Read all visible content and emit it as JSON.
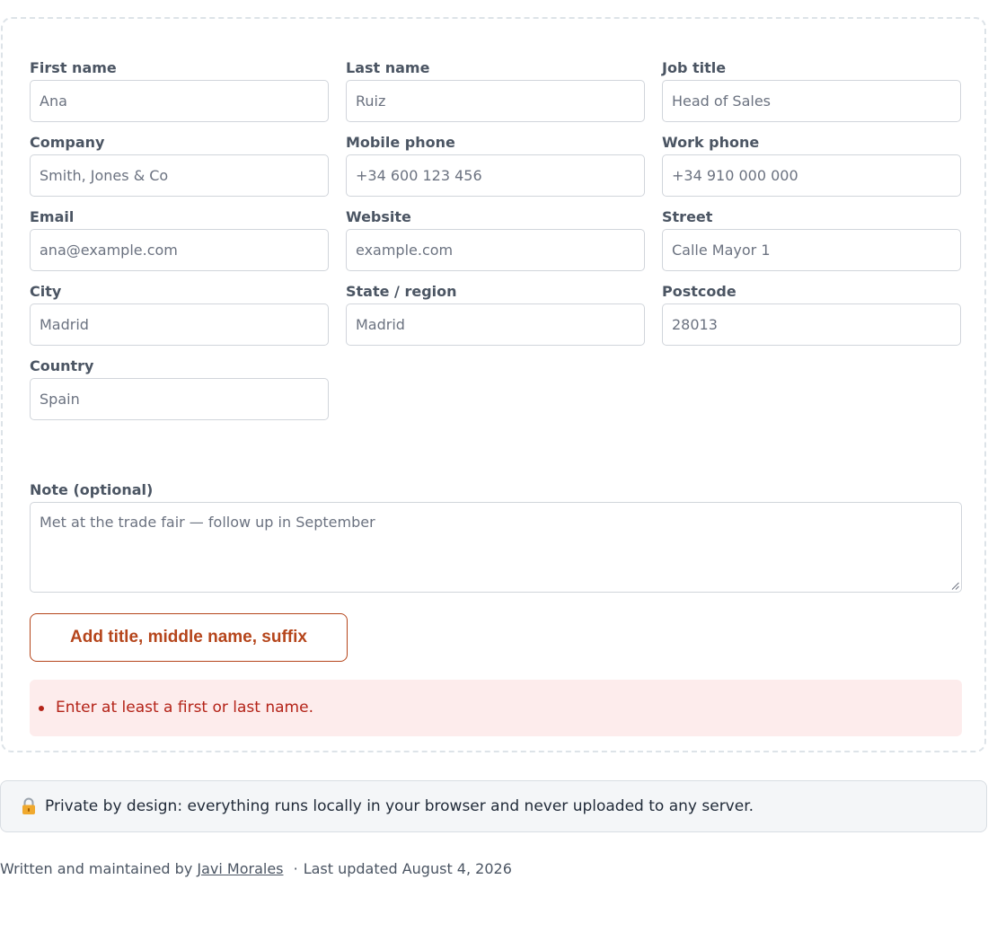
{
  "form": {
    "fields": [
      {
        "label": "First name",
        "value": "Ana"
      },
      {
        "label": "Last name",
        "value": "Ruiz"
      },
      {
        "label": "Job title",
        "value": "Head of Sales"
      },
      {
        "label": "Company",
        "value": "Smith, Jones & Co"
      },
      {
        "label": "Mobile phone",
        "value": "+34 600 123 456"
      },
      {
        "label": "Work phone",
        "value": "+34 910 000 000"
      },
      {
        "label": "Email",
        "value": "ana@example.com"
      },
      {
        "label": "Website",
        "value": "example.com"
      },
      {
        "label": "Street",
        "value": "Calle Mayor 1"
      },
      {
        "label": "City",
        "value": "Madrid"
      },
      {
        "label": "State / region",
        "value": "Madrid"
      },
      {
        "label": "Postcode",
        "value": "28013"
      },
      {
        "label": "Country",
        "value": "Spain"
      }
    ],
    "note": {
      "label": "Note (optional)",
      "value": "Met at the trade fair — follow up in September"
    },
    "add_button_label": "Add title, middle name, suffix",
    "errors": [
      "Enter at least a first or last name."
    ]
  },
  "privacy": {
    "icon": "lock-icon",
    "text": "Private by design: everything runs locally in your browser and never uploaded to any server."
  },
  "footer": {
    "prefix": "Written and maintained by",
    "author": "Javi Morales",
    "separator": "·",
    "updated": "Last updated August 4, 2026"
  },
  "colors": {
    "accent": "#b5451b",
    "error_text": "#b42318",
    "error_bg": "#fdecec"
  }
}
